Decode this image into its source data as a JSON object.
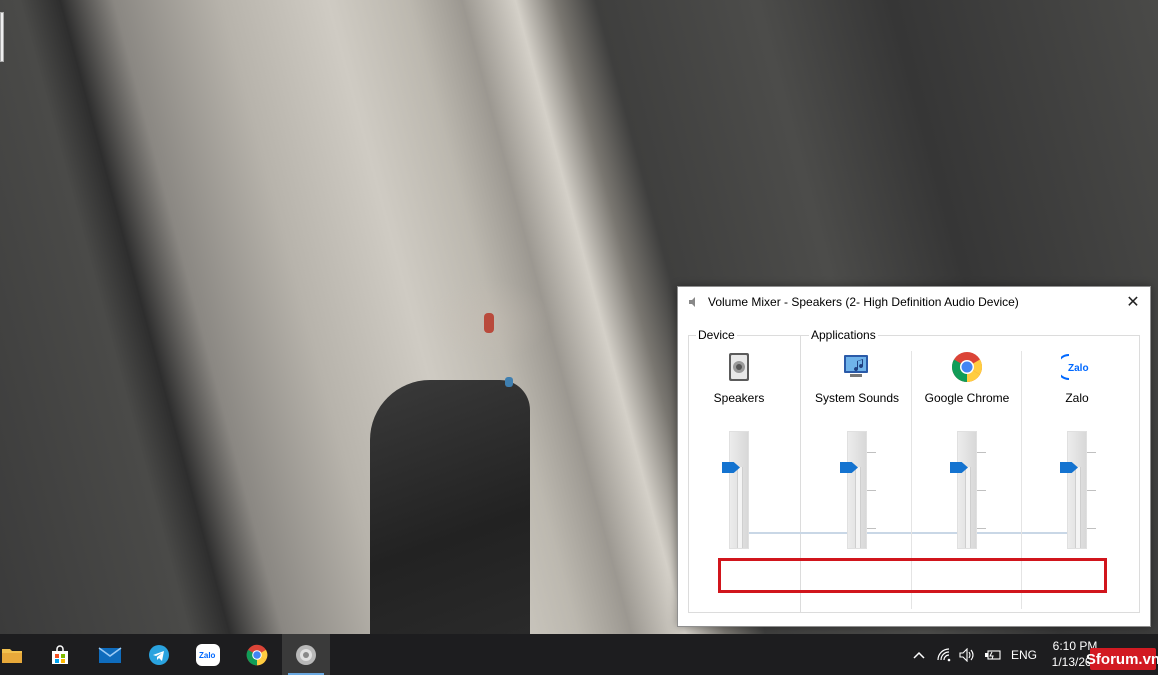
{
  "window": {
    "title": "Volume Mixer - Speakers (2- High Definition Audio Device)",
    "close_glyph": "✕"
  },
  "groups": {
    "device_label": "Device",
    "applications_label": "Applications"
  },
  "channels": [
    {
      "label": "Speakers",
      "icon": "speaker-device-icon",
      "volume_percent": 70
    },
    {
      "label": "System Sounds",
      "icon": "system-sounds-icon",
      "volume_percent": 70
    },
    {
      "label": "Google Chrome",
      "icon": "chrome-icon",
      "volume_percent": 70
    },
    {
      "label": "Zalo",
      "icon": "zalo-icon",
      "volume_percent": 70
    }
  ],
  "taskbar": {
    "apps": [
      "file-explorer-icon",
      "store-icon",
      "mail-icon",
      "telegram-icon",
      "zalo-icon",
      "chrome-icon",
      "volume-mixer-icon"
    ],
    "language": "ENG",
    "time": "6:10 PM",
    "date": "1/13/202"
  },
  "watermark": "Sforum.vn",
  "accent": "#1473d0",
  "highlight_color": "#d1151c"
}
